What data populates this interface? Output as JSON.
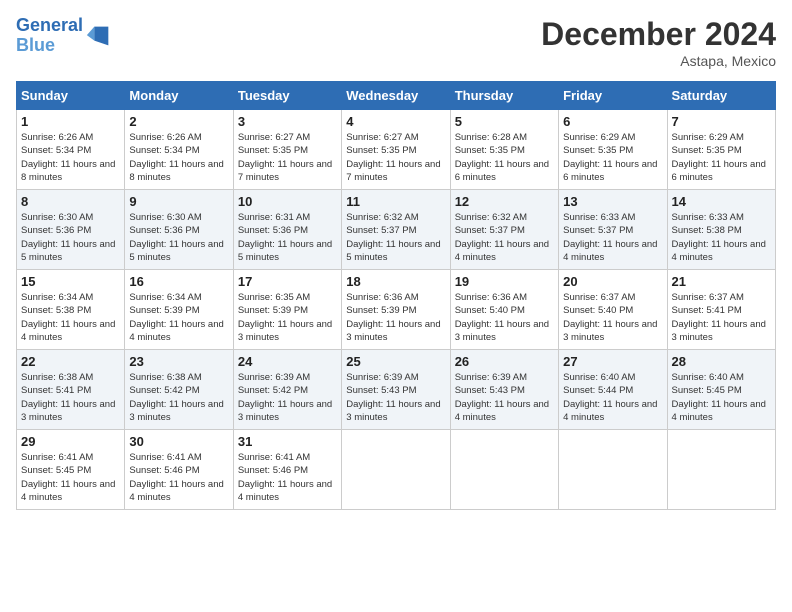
{
  "header": {
    "logo_line1": "General",
    "logo_line2": "Blue",
    "month": "December 2024",
    "location": "Astapa, Mexico"
  },
  "days_of_week": [
    "Sunday",
    "Monday",
    "Tuesday",
    "Wednesday",
    "Thursday",
    "Friday",
    "Saturday"
  ],
  "weeks": [
    [
      {
        "day": "1",
        "sunrise": "6:26 AM",
        "sunset": "5:34 PM",
        "daylight": "11 hours and 8 minutes."
      },
      {
        "day": "2",
        "sunrise": "6:26 AM",
        "sunset": "5:34 PM",
        "daylight": "11 hours and 8 minutes."
      },
      {
        "day": "3",
        "sunrise": "6:27 AM",
        "sunset": "5:35 PM",
        "daylight": "11 hours and 7 minutes."
      },
      {
        "day": "4",
        "sunrise": "6:27 AM",
        "sunset": "5:35 PM",
        "daylight": "11 hours and 7 minutes."
      },
      {
        "day": "5",
        "sunrise": "6:28 AM",
        "sunset": "5:35 PM",
        "daylight": "11 hours and 6 minutes."
      },
      {
        "day": "6",
        "sunrise": "6:29 AM",
        "sunset": "5:35 PM",
        "daylight": "11 hours and 6 minutes."
      },
      {
        "day": "7",
        "sunrise": "6:29 AM",
        "sunset": "5:35 PM",
        "daylight": "11 hours and 6 minutes."
      }
    ],
    [
      {
        "day": "8",
        "sunrise": "6:30 AM",
        "sunset": "5:36 PM",
        "daylight": "11 hours and 5 minutes."
      },
      {
        "day": "9",
        "sunrise": "6:30 AM",
        "sunset": "5:36 PM",
        "daylight": "11 hours and 5 minutes."
      },
      {
        "day": "10",
        "sunrise": "6:31 AM",
        "sunset": "5:36 PM",
        "daylight": "11 hours and 5 minutes."
      },
      {
        "day": "11",
        "sunrise": "6:32 AM",
        "sunset": "5:37 PM",
        "daylight": "11 hours and 5 minutes."
      },
      {
        "day": "12",
        "sunrise": "6:32 AM",
        "sunset": "5:37 PM",
        "daylight": "11 hours and 4 minutes."
      },
      {
        "day": "13",
        "sunrise": "6:33 AM",
        "sunset": "5:37 PM",
        "daylight": "11 hours and 4 minutes."
      },
      {
        "day": "14",
        "sunrise": "6:33 AM",
        "sunset": "5:38 PM",
        "daylight": "11 hours and 4 minutes."
      }
    ],
    [
      {
        "day": "15",
        "sunrise": "6:34 AM",
        "sunset": "5:38 PM",
        "daylight": "11 hours and 4 minutes."
      },
      {
        "day": "16",
        "sunrise": "6:34 AM",
        "sunset": "5:39 PM",
        "daylight": "11 hours and 4 minutes."
      },
      {
        "day": "17",
        "sunrise": "6:35 AM",
        "sunset": "5:39 PM",
        "daylight": "11 hours and 3 minutes."
      },
      {
        "day": "18",
        "sunrise": "6:36 AM",
        "sunset": "5:39 PM",
        "daylight": "11 hours and 3 minutes."
      },
      {
        "day": "19",
        "sunrise": "6:36 AM",
        "sunset": "5:40 PM",
        "daylight": "11 hours and 3 minutes."
      },
      {
        "day": "20",
        "sunrise": "6:37 AM",
        "sunset": "5:40 PM",
        "daylight": "11 hours and 3 minutes."
      },
      {
        "day": "21",
        "sunrise": "6:37 AM",
        "sunset": "5:41 PM",
        "daylight": "11 hours and 3 minutes."
      }
    ],
    [
      {
        "day": "22",
        "sunrise": "6:38 AM",
        "sunset": "5:41 PM",
        "daylight": "11 hours and 3 minutes."
      },
      {
        "day": "23",
        "sunrise": "6:38 AM",
        "sunset": "5:42 PM",
        "daylight": "11 hours and 3 minutes."
      },
      {
        "day": "24",
        "sunrise": "6:39 AM",
        "sunset": "5:42 PM",
        "daylight": "11 hours and 3 minutes."
      },
      {
        "day": "25",
        "sunrise": "6:39 AM",
        "sunset": "5:43 PM",
        "daylight": "11 hours and 3 minutes."
      },
      {
        "day": "26",
        "sunrise": "6:39 AM",
        "sunset": "5:43 PM",
        "daylight": "11 hours and 4 minutes."
      },
      {
        "day": "27",
        "sunrise": "6:40 AM",
        "sunset": "5:44 PM",
        "daylight": "11 hours and 4 minutes."
      },
      {
        "day": "28",
        "sunrise": "6:40 AM",
        "sunset": "5:45 PM",
        "daylight": "11 hours and 4 minutes."
      }
    ],
    [
      {
        "day": "29",
        "sunrise": "6:41 AM",
        "sunset": "5:45 PM",
        "daylight": "11 hours and 4 minutes."
      },
      {
        "day": "30",
        "sunrise": "6:41 AM",
        "sunset": "5:46 PM",
        "daylight": "11 hours and 4 minutes."
      },
      {
        "day": "31",
        "sunrise": "6:41 AM",
        "sunset": "5:46 PM",
        "daylight": "11 hours and 4 minutes."
      },
      null,
      null,
      null,
      null
    ]
  ]
}
